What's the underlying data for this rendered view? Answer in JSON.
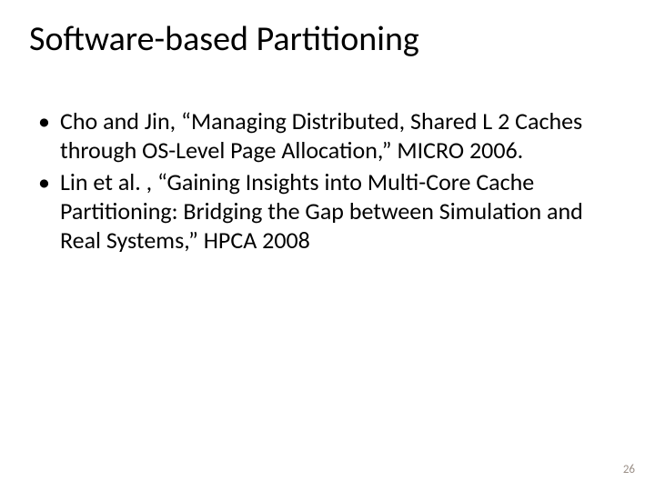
{
  "title": "Software-based Partitioning",
  "bullets": [
    {
      "prefix": "Cho and Jin, ",
      "open_quote": "“",
      "title": "Managing Distributed, Shared L 2 Caches through OS-Level Page Allocation,",
      "close_quote": "”",
      "suffix": " MICRO 2006."
    },
    {
      "prefix": "Lin et al. , ",
      "open_quote": "“",
      "title": "Gaining Insights into Multi-Core Cache Partitioning: Bridging the Gap between Simulation and Real Systems,",
      "close_quote": "”",
      "suffix": " HPCA 2008"
    }
  ],
  "page_number": "26"
}
